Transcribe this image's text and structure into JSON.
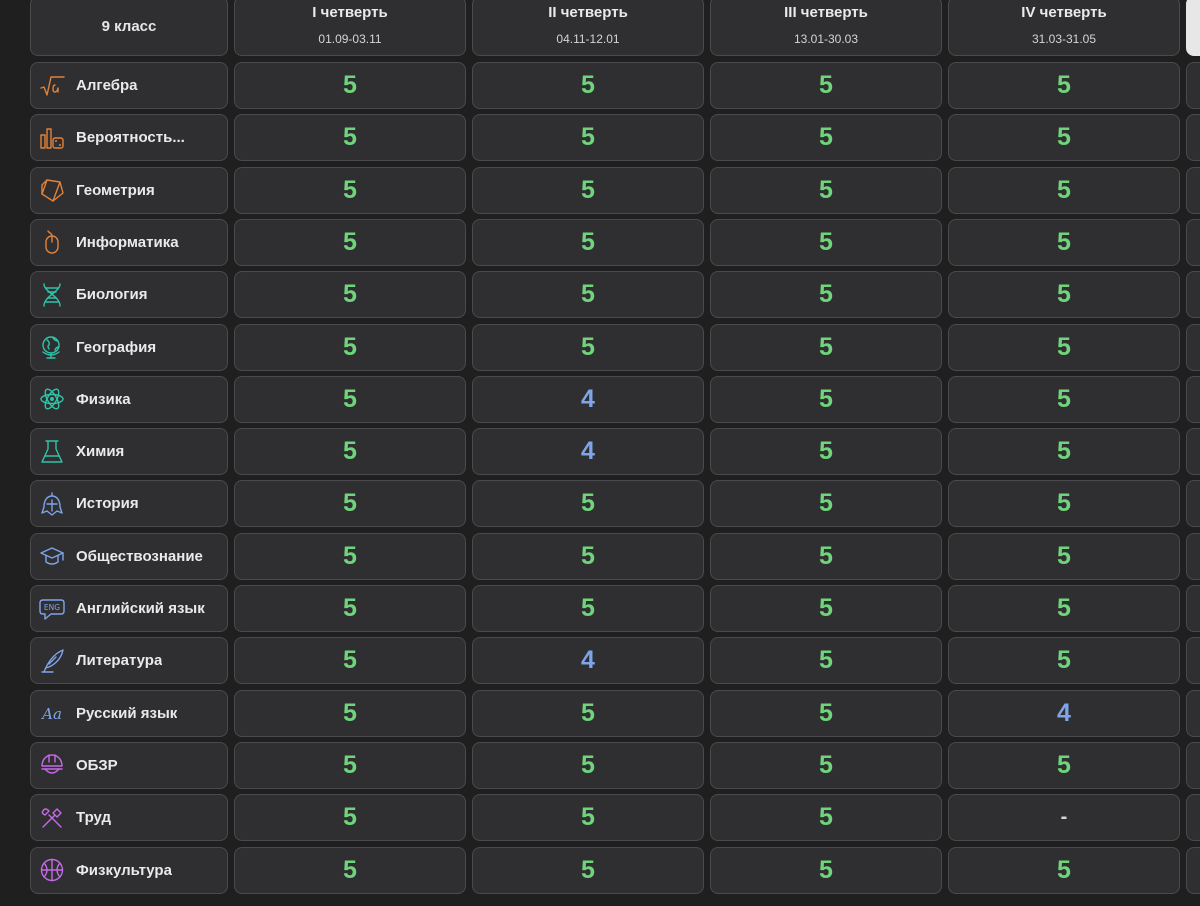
{
  "header": {
    "class_label": "9 класс",
    "quarters": [
      {
        "title": "I четверть",
        "range": "01.09-03.11"
      },
      {
        "title": "II четверть",
        "range": "04.11-12.01"
      },
      {
        "title": "III четверть",
        "range": "13.01-30.03"
      },
      {
        "title": "IV четверть",
        "range": "31.03-31.05"
      }
    ]
  },
  "subjects": [
    {
      "name": "Алгебра",
      "icon": "sqrt-icon",
      "icon_color": "#e0823a",
      "grades": [
        "5",
        "5",
        "5",
        "5"
      ]
    },
    {
      "name": "Вероятность...",
      "icon": "dice-chart-icon",
      "icon_color": "#e0823a",
      "grades": [
        "5",
        "5",
        "5",
        "5"
      ]
    },
    {
      "name": "Геометрия",
      "icon": "polygon-icon",
      "icon_color": "#e0823a",
      "grades": [
        "5",
        "5",
        "5",
        "5"
      ]
    },
    {
      "name": "Информатика",
      "icon": "mouse-icon",
      "icon_color": "#e0823a",
      "grades": [
        "5",
        "5",
        "5",
        "5"
      ]
    },
    {
      "name": "Биология",
      "icon": "dna-icon",
      "icon_color": "#2fc4a8",
      "grades": [
        "5",
        "5",
        "5",
        "5"
      ]
    },
    {
      "name": "География",
      "icon": "globe-icon",
      "icon_color": "#2fc4a8",
      "grades": [
        "5",
        "5",
        "5",
        "5"
      ]
    },
    {
      "name": "Физика",
      "icon": "atom-icon",
      "icon_color": "#2fc4a8",
      "grades": [
        "5",
        "4",
        "5",
        "5"
      ]
    },
    {
      "name": "Химия",
      "icon": "flask-icon",
      "icon_color": "#2fc4a8",
      "grades": [
        "5",
        "4",
        "5",
        "5"
      ]
    },
    {
      "name": "История",
      "icon": "helmet-icon",
      "icon_color": "#7ea4e9",
      "grades": [
        "5",
        "5",
        "5",
        "5"
      ]
    },
    {
      "name": "Обществознание",
      "icon": "graduation-cap-icon",
      "icon_color": "#7ea4e9",
      "grades": [
        "5",
        "5",
        "5",
        "5"
      ]
    },
    {
      "name": "Английский язык",
      "icon": "eng-bubble-icon",
      "icon_color": "#7ea4e9",
      "icon_text": "ENG",
      "grades": [
        "5",
        "5",
        "5",
        "5"
      ]
    },
    {
      "name": "Литература",
      "icon": "quill-icon",
      "icon_color": "#7ea4e9",
      "grades": [
        "5",
        "4",
        "5",
        "5"
      ]
    },
    {
      "name": "Русский язык",
      "icon": "letters-icon",
      "icon_color": "#7ea4e9",
      "icon_text": "Aa",
      "grades": [
        "5",
        "5",
        "5",
        "4"
      ]
    },
    {
      "name": "ОБЗР",
      "icon": "hardhat-icon",
      "icon_color": "#c46be6",
      "grades": [
        "5",
        "5",
        "5",
        "5"
      ]
    },
    {
      "name": "Труд",
      "icon": "tools-icon",
      "icon_color": "#c46be6",
      "grades": [
        "5",
        "5",
        "5",
        "-"
      ]
    },
    {
      "name": "Физкультура",
      "icon": "ball-icon",
      "icon_color": "#c46be6",
      "grades": [
        "5",
        "5",
        "5",
        "5"
      ]
    }
  ],
  "grade_colors": {
    "5": "#6fd47b",
    "4": "#7ea4e9",
    "-": "#d8d8d8"
  }
}
